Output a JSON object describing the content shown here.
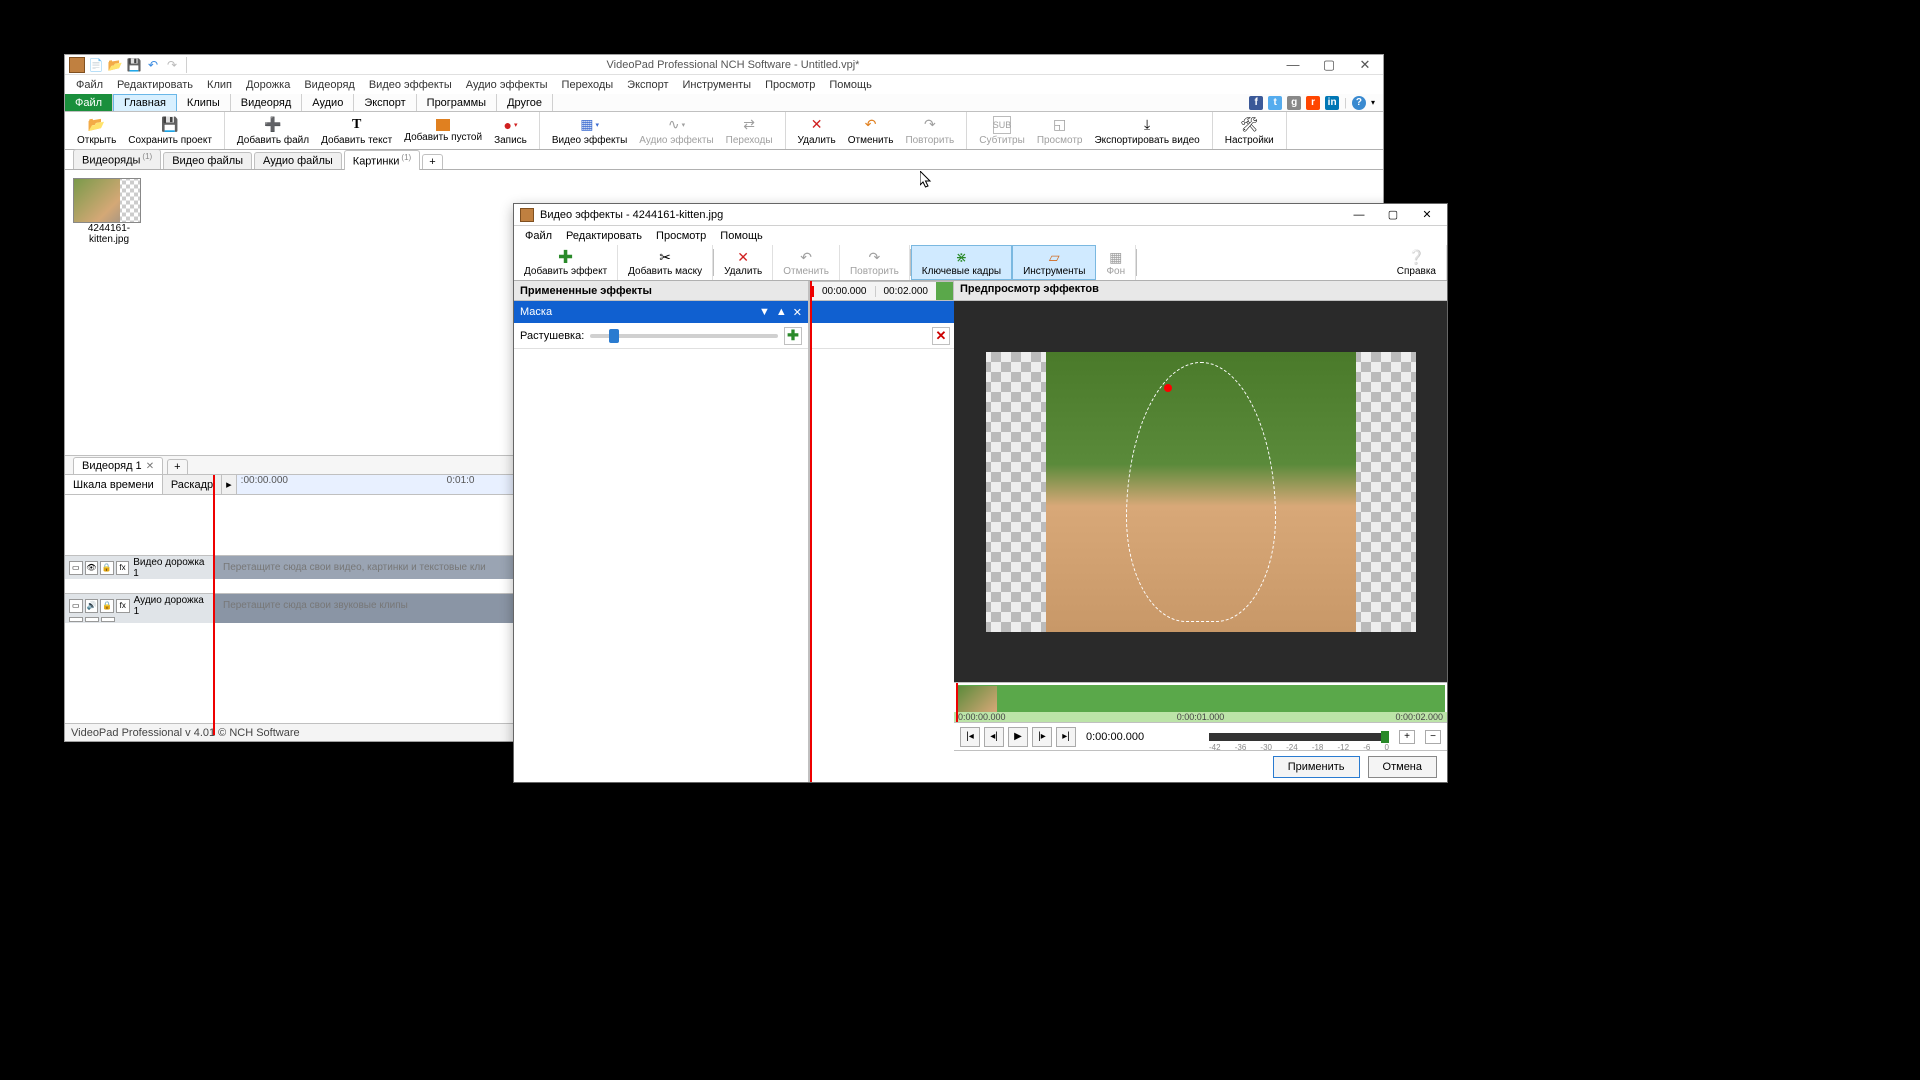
{
  "app": {
    "title": "VideoPad Professional NCH Software - Untitled.vpj*",
    "status": "VideoPad Professional v 4.01 © NCH Software"
  },
  "menubar": [
    "Файл",
    "Редактировать",
    "Клип",
    "Дорожка",
    "Видеоряд",
    "Видео эффекты",
    "Аудио эффекты",
    "Переходы",
    "Экспорт",
    "Инструменты",
    "Просмотр",
    "Помощь"
  ],
  "main_tabs": {
    "file": "Файл",
    "items": [
      "Главная",
      "Клипы",
      "Видеоряд",
      "Аудио",
      "Экспорт",
      "Программы",
      "Другое"
    ],
    "active": 0
  },
  "ribbon": {
    "open": "Открыть",
    "save": "Сохранить проект",
    "addfile": "Добавить файл",
    "addtext": "Добавить текст",
    "addblank": "Добавить пустой",
    "record": "Запись",
    "vfx": "Видео эффекты",
    "afx": "Аудио эффекты",
    "trans": "Переходы",
    "delete": "Удалить",
    "undo": "Отменить",
    "redo": "Повторить",
    "subs": "Субтитры",
    "preview": "Просмотр",
    "export": "Экспортировать видео",
    "settings": "Настройки"
  },
  "bin_tabs": {
    "items": [
      "Видеоряды",
      "Видео файлы",
      "Аудио файлы",
      "Картинки"
    ],
    "active": 3
  },
  "bin": {
    "thumb_label": "4244161-kitten.jpg"
  },
  "seq": {
    "name": "Видеоряд 1"
  },
  "timeline": {
    "mode_time": "Шкала времени",
    "mode_story": "Раскадр",
    "t0": ":00:00.000",
    "t1": "0:01:0",
    "video_track": "Видео дорожка 1",
    "video_hint": "Перетащите сюда свои видео, картинки и текстовые кли",
    "audio_track": "Аудио дорожка 1",
    "audio_hint": "Перетащите сюда свои звуковые клипы"
  },
  "fx": {
    "title": "Видео эффекты - 4244161-kitten.jpg",
    "menu": [
      "Файл",
      "Редактировать",
      "Просмотр",
      "Помощь"
    ],
    "r_addfx": "Добавить эффект",
    "r_addmask": "Добавить маску",
    "r_delete": "Удалить",
    "r_undo": "Отменить",
    "r_redo": "Повторить",
    "r_keyf": "Ключевые кадры",
    "r_tools": "Инструменты",
    "r_bg": "Фон",
    "r_help": "Справка",
    "applied_head": "Примененные эффекты",
    "kf_start": "00:00.000",
    "kf_end": "00:02.000",
    "effect_name": "Маска",
    "param_feather": "Растушевка:",
    "preview_head": "Предпросмотр эффектов",
    "tl_t0": "0:00:00.000",
    "tl_t1": "0:00:01.000",
    "tl_t2": "0:00:02.000",
    "cur_time": "0:00:00.000",
    "zoom_ticks": [
      "-42",
      "-36",
      "-30",
      "-24",
      "-18",
      "-12",
      "-6",
      "0"
    ],
    "btn_apply": "Применить",
    "btn_cancel": "Отмена"
  }
}
